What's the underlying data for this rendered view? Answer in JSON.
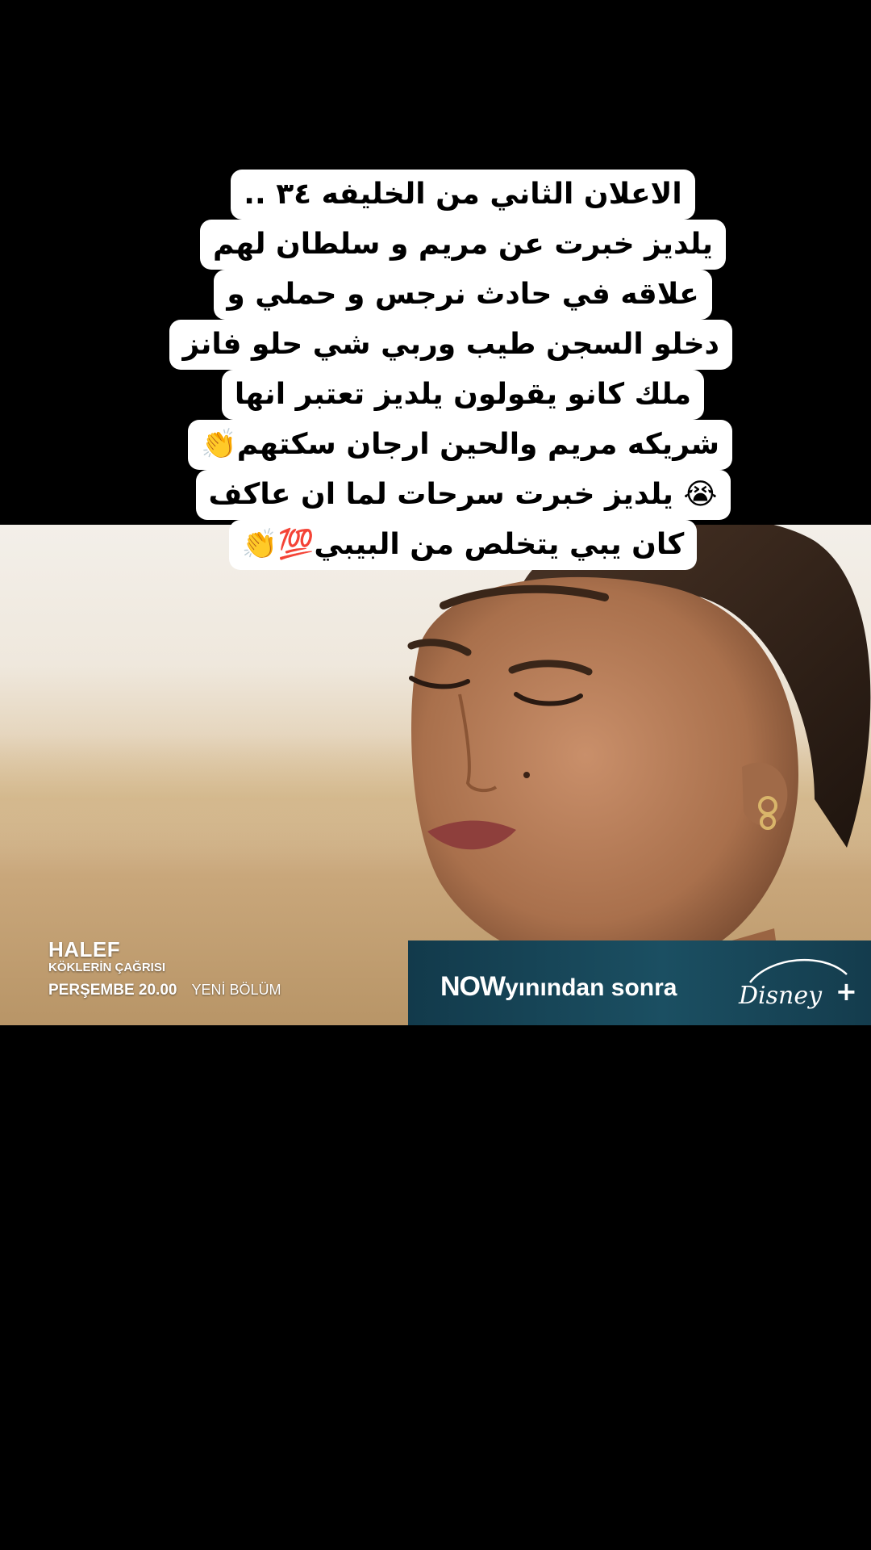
{
  "caption": {
    "lines": [
      "الاعلان الثاني من الخليفه ٣٤ ..",
      "يلديز خبرت عن مريم و سلطان لهم",
      "علاقه في حادث نرجس و حملي و",
      "دخلو السجن طيب وربي شي حلو فانز",
      "ملك كانو يقولون يلديز تعتبر انها",
      "شريكه مريم والحين ارجان سكتهم👏",
      "😭 يلديز خبرت سرحات لما ان عاكف",
      "كان يبي يتخلص من البيبي💯👏"
    ]
  },
  "show_logo": {
    "title": "HALEF",
    "subtitle": "KÖKLERİN ÇAĞRISI",
    "schedule": "PERŞEMBE 20.00",
    "episode": "YENİ BÖLÜM"
  },
  "broadcast_bar": {
    "now_logo": "NOW",
    "text": "yınından sonra",
    "partner_logo": "Disney+"
  },
  "colors": {
    "background": "#000000",
    "caption_bg": "#ffffff",
    "brand_bar": "#1b4f62"
  }
}
